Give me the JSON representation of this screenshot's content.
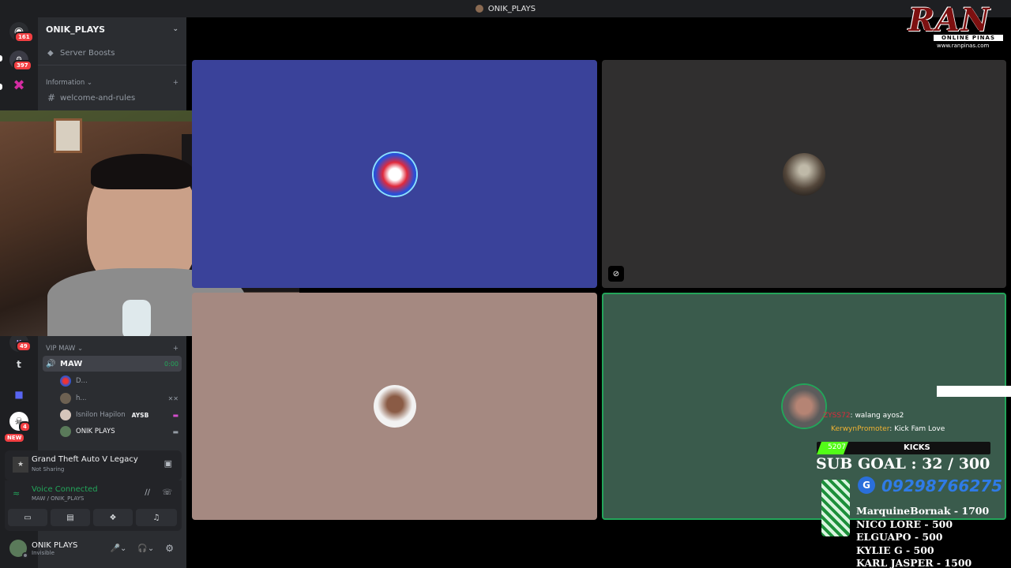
{
  "window": {
    "title": "ONIK_PLAYS"
  },
  "rail": {
    "badges": {
      "first": "161",
      "second": "397",
      "kaiju": "49",
      "skull": "4",
      "new": "NEW"
    },
    "t_icon": "t"
  },
  "sidebar": {
    "server_name": "ONIK_PLAYS",
    "boosts": "Server Boosts",
    "category_info": "Information",
    "channel_welcome": "welcome-and-rules",
    "category_vip": "VIP MAW",
    "voice_channel": {
      "name": "MAW",
      "time": "0:00"
    },
    "voice_users": [
      {
        "name": "D...",
        "tag": ""
      },
      {
        "name": "h...",
        "tag": ""
      },
      {
        "name": "Isnilon Hapilon",
        "tag": "AYSB"
      },
      {
        "name": "ONIK PLAYS",
        "tag": ""
      }
    ]
  },
  "activity": {
    "game": "Grand Theft Auto V Legacy",
    "status": "Not Sharing"
  },
  "voice_status": {
    "label": "Voice Connected",
    "location": "MAW / ONIK_PLAYS"
  },
  "user": {
    "name": "ONIK PLAYS",
    "status": "Invisible"
  },
  "colors": {
    "tile_blue": "#3a429a",
    "tile_gray": "#302f2f",
    "tile_pink": "#a58981",
    "tile_green": "#3a5b4c",
    "voice_green": "#23a55a"
  },
  "overlay": {
    "logo_text": "RAN",
    "logo_sub": "ONLINE PINAS",
    "logo_url": "www.ranpinas.com",
    "chat": [
      {
        "user": "ZYSS72",
        "msg": ": walang ayos2"
      },
      {
        "user": "KerwynPromoter",
        "msg": ": Kick Fam Love"
      }
    ],
    "kicks_count": "5207",
    "kicks_label": "KICKS",
    "sub_goal": "SUB GOAL : 32 / 300",
    "phone": "09298766275",
    "donors": [
      "MarquineBornak - 1700",
      "NICO LORE - 500",
      "ELGUAPO - 500",
      "KYLIE G - 500",
      "KARL JASPER - 1500"
    ]
  }
}
